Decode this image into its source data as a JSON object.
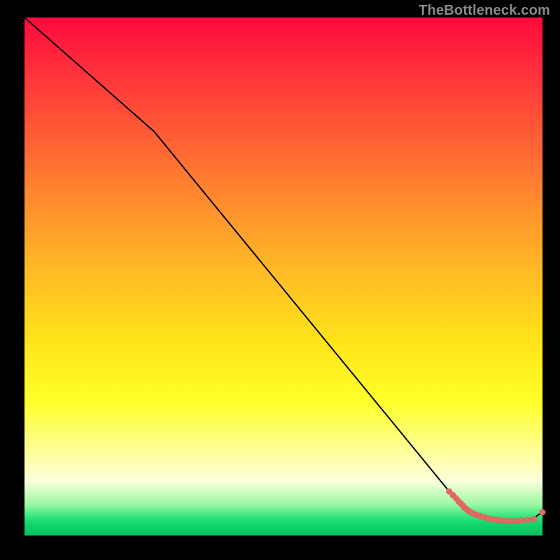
{
  "watermark": "TheBottleneck.com",
  "colors": {
    "line": "#000000",
    "points": "#e46a64",
    "points_stroke": "#d55a54"
  },
  "chart_data": {
    "type": "line",
    "title": "",
    "xlabel": "",
    "ylabel": "",
    "xlim": [
      0,
      100
    ],
    "ylim": [
      0,
      100
    ],
    "grid": false,
    "legend": false,
    "series": [
      {
        "name": "curve",
        "style": "line",
        "x": [
          0,
          25,
          82,
          86,
          88,
          90,
          92,
          94,
          96,
          98,
          100
        ],
        "y": [
          100,
          78,
          8.5,
          5.0,
          3.6,
          3.0,
          2.8,
          2.8,
          2.9,
          3.2,
          4.5
        ]
      },
      {
        "name": "points-cluster",
        "style": "scatter",
        "x": [
          82.0,
          82.7,
          83.3,
          83.8,
          84.3,
          84.7,
          85.0,
          85.4,
          85.8,
          86.2,
          86.7,
          87.3,
          88.0,
          88.8,
          89.5,
          90.3,
          91.2,
          92.0,
          93.0,
          94.0,
          95.0,
          96.0,
          97.2,
          98.4,
          100.0
        ],
        "y": [
          8.5,
          7.8,
          7.2,
          6.6,
          6.1,
          5.7,
          5.3,
          5.0,
          4.7,
          4.5,
          4.2,
          4.0,
          3.7,
          3.5,
          3.3,
          3.1,
          3.0,
          2.9,
          2.85,
          2.8,
          2.85,
          2.9,
          3.0,
          3.2,
          4.5
        ]
      }
    ]
  }
}
